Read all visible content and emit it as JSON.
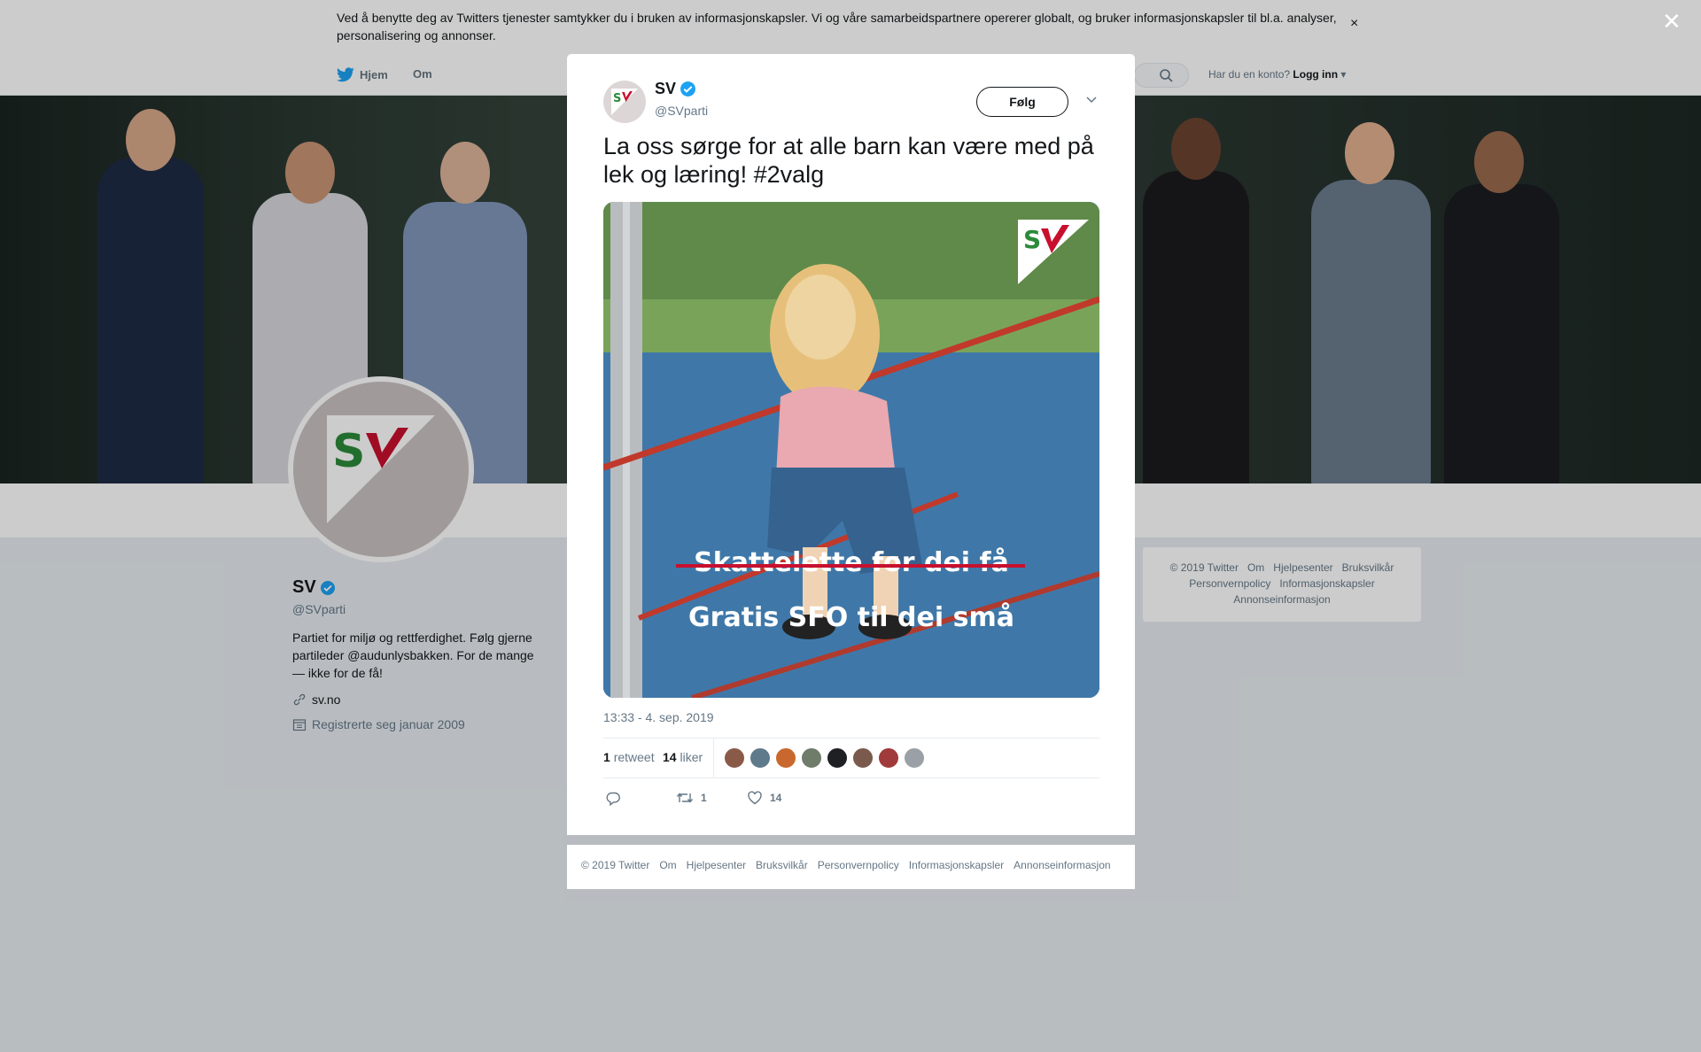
{
  "cookie_banner": {
    "text": "Ved å benytte deg av Twitters tjenester samtykker du i bruken av informasjonskapsler. Vi og våre samarbeidspartnere opererer globalt, og bruker informasjonskapsler til bl.a. analyser, personalisering og annonser.",
    "close": "×"
  },
  "nav": {
    "home": "Hjem",
    "about": "Om",
    "account_prompt": "Har du en konto?",
    "login": "Logg inn"
  },
  "profile": {
    "name": "SV",
    "handle": "@SVparti",
    "bio": "Partiet for miljø og rettferdighet. Følg gjerne partileder @audunlysbakken. For de mange — ikke for de få!",
    "url": "sv.no",
    "joined": "Registrerte seg januar 2009"
  },
  "side_footer": {
    "links": [
      "© 2019 Twitter",
      "Om",
      "Hjelpesenter",
      "Bruksvilkår",
      "Personvernpolicy",
      "Informasjonskapsler",
      "Annonseinformasjon"
    ]
  },
  "overlay": {
    "close": "✕"
  },
  "tweet": {
    "name": "SV",
    "handle": "@SVparti",
    "follow_label": "Følg",
    "text": "La oss sørge for at alle barn kan være med på lek og læring! #2valg",
    "media": {
      "caption_struck": "Skattelette for dei få",
      "caption": "Gratis SFO til dei små",
      "logo": "SV"
    },
    "timestamp": "13:33 - 4. sep. 2019",
    "retweets_count": "1",
    "retweets_label": "retweet",
    "likes_count": "14",
    "likes_label": "liker",
    "action_retweet_count": "1",
    "action_like_count": "14"
  },
  "modal_footer": {
    "links": [
      "© 2019 Twitter",
      "Om",
      "Hjelpesenter",
      "Bruksvilkår",
      "Personvernpolicy",
      "Informasjonskapsler",
      "Annonseinformasjon"
    ]
  },
  "colors": {
    "sv_red": "#c8102e",
    "sv_green": "#2c8a3a",
    "verified_blue": "#1da1f2",
    "twitter_blue": "#1da1f2"
  },
  "icons": [
    "twitter-bird-icon",
    "search-icon",
    "caret-down-icon",
    "verified-badge-icon",
    "link-icon",
    "calendar-icon",
    "reply-icon",
    "retweet-icon",
    "like-icon",
    "close-icon"
  ]
}
